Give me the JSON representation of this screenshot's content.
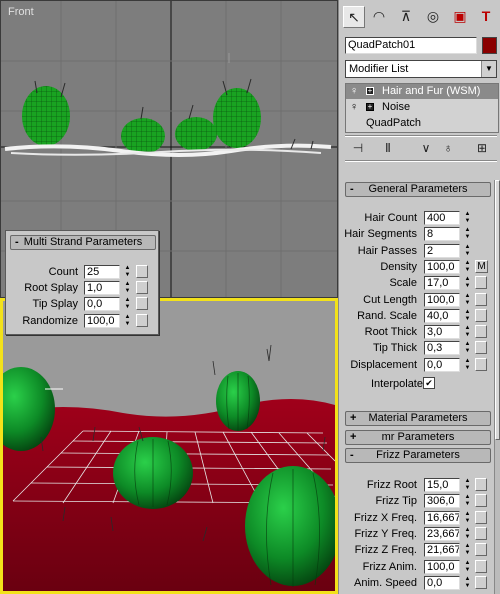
{
  "viewport_front": {
    "label": "Front"
  },
  "multi_strand": {
    "title": "Multi Strand Parameters",
    "collapse_sign": "-",
    "params": [
      {
        "label": "Count",
        "value": "25"
      },
      {
        "label": "Root Splay",
        "value": "1,0"
      },
      {
        "label": "Tip Splay",
        "value": "0,0"
      },
      {
        "label": "Randomize",
        "value": "100,0"
      }
    ]
  },
  "command_panel": {
    "tabs": [
      {
        "icon": "cursor-arrow-icon",
        "glyph": "↖"
      },
      {
        "icon": "modify-rainbow-icon",
        "glyph": "◠"
      },
      {
        "icon": "hierarchy-icon",
        "glyph": "⊼"
      },
      {
        "icon": "motion-icon",
        "glyph": "◎"
      },
      {
        "icon": "display-monitor-icon",
        "glyph": "▣"
      },
      {
        "icon": "utilities-hammer-icon",
        "glyph": "T"
      }
    ],
    "object_name": "QuadPatch01",
    "object_color": "#8a0000",
    "modifier_list_label": "Modifier List",
    "stack": [
      {
        "label": "Hair and Fur (WSM)",
        "selected": true
      },
      {
        "label": "Noise",
        "selected": false
      },
      {
        "label": "QuadPatch",
        "selected": false
      }
    ],
    "stack_tools": [
      {
        "icon": "pin-stack-icon",
        "glyph": "⊣"
      },
      {
        "icon": "show-end-result-icon",
        "glyph": "Ⅱ"
      },
      {
        "icon": "make-unique-icon",
        "glyph": "∨"
      },
      {
        "icon": "remove-modifier-icon",
        "glyph": "♁"
      },
      {
        "icon": "configure-sets-icon",
        "glyph": "⊞"
      }
    ]
  },
  "general": {
    "title": "General Parameters",
    "collapse_sign": "-",
    "params": [
      {
        "label": "Hair Count",
        "value": "400"
      },
      {
        "label": "Hair Segments",
        "value": "8"
      },
      {
        "label": "Hair Passes",
        "value": "2"
      },
      {
        "label": "Density",
        "value": "100,0"
      },
      {
        "label": "Scale",
        "value": "17,0"
      },
      {
        "label": "Cut Length",
        "value": "100,0"
      },
      {
        "label": "Rand. Scale",
        "value": "40,0"
      },
      {
        "label": "Root Thick",
        "value": "3,0"
      },
      {
        "label": "Tip Thick",
        "value": "0,3"
      },
      {
        "label": "Displacement",
        "value": "0,0"
      }
    ],
    "map_button": "M",
    "interpolate_label": "Interpolate",
    "interpolate_checked": "✔"
  },
  "collapsed_rollouts": [
    {
      "sign": "+",
      "title": "Material Parameters"
    },
    {
      "sign": "+",
      "title": "mr Parameters"
    }
  ],
  "frizz": {
    "title": "Frizz Parameters",
    "collapse_sign": "-",
    "params": [
      {
        "label": "Frizz Root",
        "value": "15,0"
      },
      {
        "label": "Frizz Tip",
        "value": "306,0"
      },
      {
        "label": "Frizz X Freq.",
        "value": "16,667"
      },
      {
        "label": "Frizz Y Freq.",
        "value": "23,667"
      },
      {
        "label": "Frizz Z Freq.",
        "value": "21,667"
      },
      {
        "label": "Frizz Anim.",
        "value": "100,0"
      },
      {
        "label": "Anim. Speed",
        "value": "0,0"
      }
    ]
  }
}
